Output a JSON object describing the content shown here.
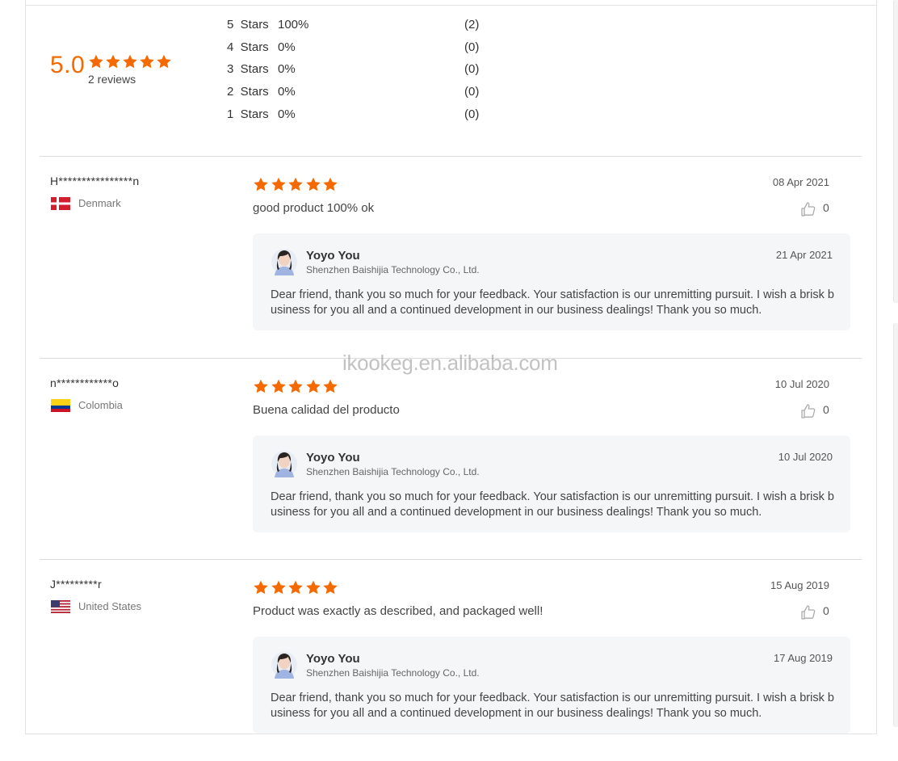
{
  "summary": {
    "score": "5.0",
    "stars": 5,
    "reviews_label": "2 reviews",
    "distribution": [
      {
        "label": "5  Stars",
        "percent": "100%",
        "count": "(2)"
      },
      {
        "label": "4  Stars",
        "percent": "0%",
        "count": "(0)"
      },
      {
        "label": "3  Stars",
        "percent": "0%",
        "count": "(0)"
      },
      {
        "label": "2  Stars",
        "percent": "0%",
        "count": "(0)"
      },
      {
        "label": "1  Stars",
        "percent": "0%",
        "count": "(0)"
      }
    ]
  },
  "colors": {
    "star": "#f56a00",
    "score": "#f56a00",
    "reply_bg": "#f5f6f8"
  },
  "reviews": [
    {
      "reviewer": "H****************n",
      "country": "Denmark",
      "flag_icon": "denmark-flag-icon",
      "rating": 5,
      "date": "08 Apr 2021",
      "text": "good product 100% ok",
      "likes": "0",
      "reply": {
        "seller": "Yoyo You",
        "company": "Shenzhen Baishijia Technology Co., Ltd.",
        "date": "21 Apr 2021",
        "text": "Dear friend, thank you so much for your feedback. Your satisfaction is our unremitting pursuit. I wish a brisk business for you all and a continued development in our business dealings! Thank you so much."
      }
    },
    {
      "reviewer": "n************o",
      "country": "Colombia",
      "flag_icon": "colombia-flag-icon",
      "rating": 5,
      "date": "10 Jul 2020",
      "text": "Buena calidad del producto",
      "likes": "0",
      "reply": {
        "seller": "Yoyo You",
        "company": "Shenzhen Baishijia Technology Co., Ltd.",
        "date": "10 Jul 2020",
        "text": "Dear friend, thank you so much for your feedback. Your satisfaction is our unremitting pursuit. I wish a brisk business for you all and a continued development in our business dealings! Thank you so much."
      }
    },
    {
      "reviewer": "J*********r",
      "country": "United States",
      "flag_icon": "united-states-flag-icon",
      "rating": 5,
      "date": "15 Aug 2019",
      "text": "Product was exactly as described, and packaged well!",
      "likes": "0",
      "reply": {
        "seller": "Yoyo You",
        "company": "Shenzhen Baishijia Technology Co., Ltd.",
        "date": "17 Aug 2019",
        "text": "Dear friend, thank you so much for your feedback. Your satisfaction is our unremitting pursuit. I wish a brisk business for you all and a continued development in our business dealings! Thank you so much."
      }
    }
  ],
  "watermark": "ikookeg.en.alibaba.com"
}
